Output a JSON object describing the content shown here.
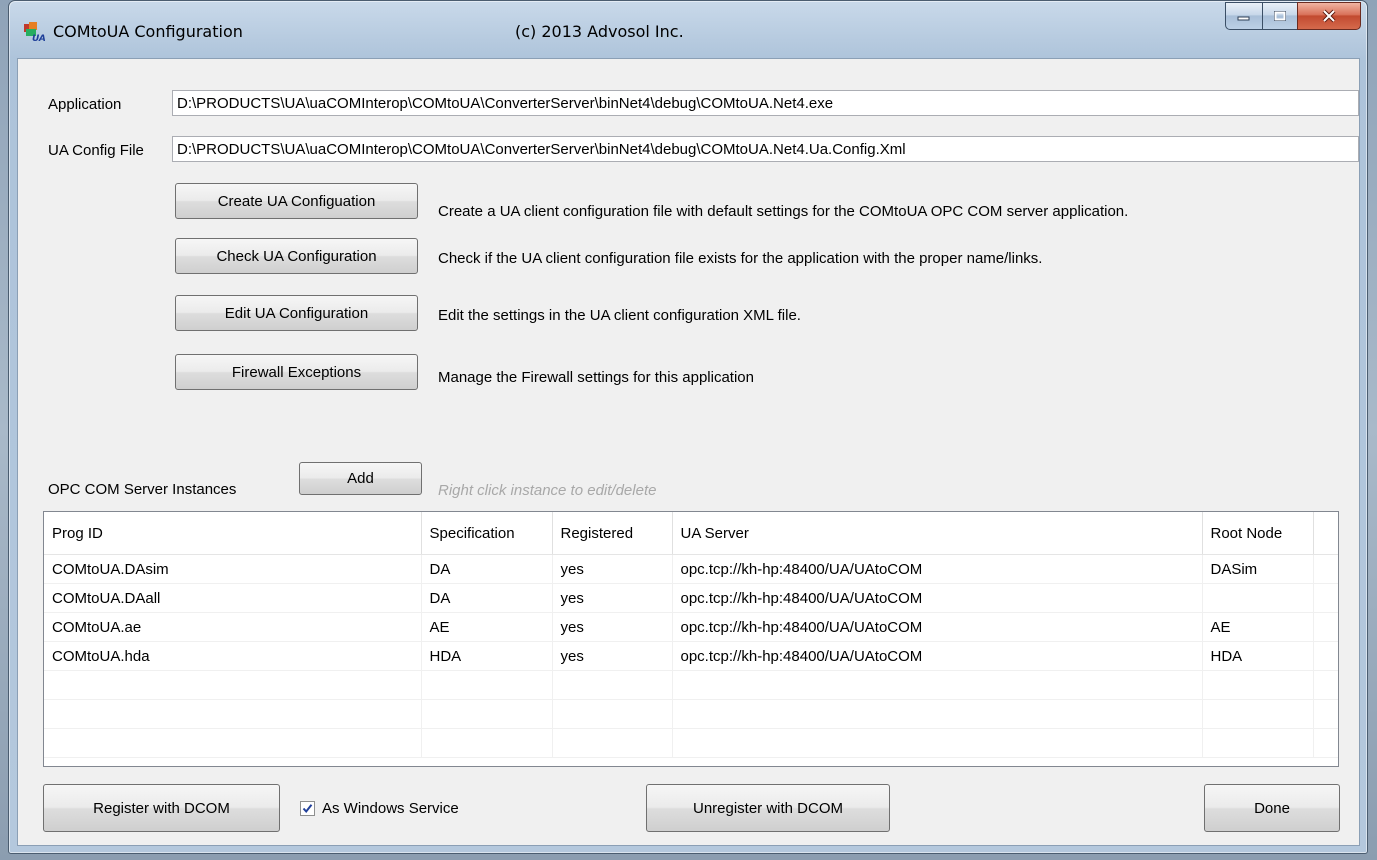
{
  "window": {
    "title": "COMtoUA Configuration",
    "copyright": "(c) 2013 Advosol Inc.",
    "minimize_glyph": "minimize-icon",
    "maximize_glyph": "maximize-icon",
    "close_glyph": "close-icon"
  },
  "fields": {
    "application_label": "Application",
    "application_value": "D:\\PRODUCTS\\UA\\uaCOMInterop\\COMtoUA\\ConverterServer\\binNet4\\debug\\COMtoUA.Net4.exe",
    "config_label": "UA Config File",
    "config_value": "D:\\PRODUCTS\\UA\\uaCOMInterop\\COMtoUA\\ConverterServer\\binNet4\\debug\\COMtoUA.Net4.Ua.Config.Xml"
  },
  "actions": [
    {
      "label": "Create UA Configuation",
      "desc": "Create a UA client configuration file with default settings for the COMtoUA OPC COM server application."
    },
    {
      "label": "Check UA Configuration",
      "desc": "Check if the UA client configuration file exists for the application with the proper name/links."
    },
    {
      "label": "Edit UA Configuration",
      "desc": "Edit the settings in the UA client configuration XML file."
    },
    {
      "label": "Firewall Exceptions",
      "desc": "Manage the Firewall settings for this application"
    }
  ],
  "instances": {
    "label": "OPC COM Server Instances",
    "add_label": "Add",
    "hint": "Right click instance to edit/delete",
    "columns": [
      "Prog ID",
      "Specification",
      "Registered",
      "UA Server",
      "Root Node"
    ],
    "rows": [
      [
        "COMtoUA.DAsim",
        "DA",
        "yes",
        "opc.tcp://kh-hp:48400/UA/UAtoCOM",
        "DASim"
      ],
      [
        "COMtoUA.DAall",
        "DA",
        "yes",
        "opc.tcp://kh-hp:48400/UA/UAtoCOM",
        ""
      ],
      [
        "COMtoUA.ae",
        "AE",
        "yes",
        "opc.tcp://kh-hp:48400/UA/UAtoCOM",
        "AE"
      ],
      [
        "COMtoUA.hda",
        "HDA",
        "yes",
        "opc.tcp://kh-hp:48400/UA/UAtoCOM",
        "HDA"
      ]
    ]
  },
  "footer": {
    "register_label": "Register with DCOM",
    "service_label": "As Windows Service",
    "service_checked": true,
    "unregister_label": "Unregister with DCOM",
    "done_label": "Done"
  }
}
